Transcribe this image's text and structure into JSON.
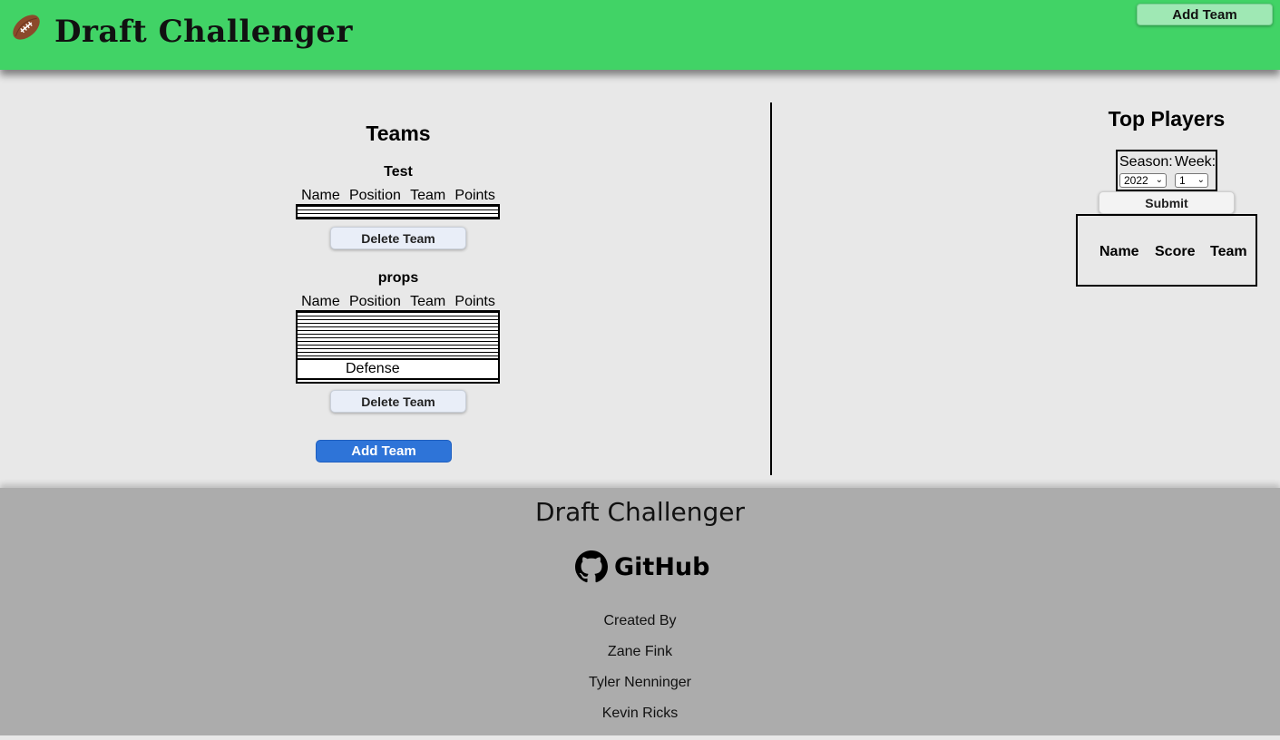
{
  "header": {
    "title": "Draft Challenger",
    "add_team_label": "Add Team",
    "logo_icon": "football-icon",
    "background_color": "#41d366"
  },
  "teams_panel": {
    "heading": "Teams",
    "columns": [
      "Name",
      "Position",
      "Team",
      "Points"
    ],
    "teams": [
      {
        "name": "Test",
        "rows": []
      },
      {
        "name": "props",
        "rows": [
          {
            "name": "",
            "position": "Defense",
            "team": "",
            "points": ""
          }
        ]
      }
    ],
    "delete_label": "Delete Team",
    "add_team_label": "Add Team",
    "add_team_color": "#2e74d8"
  },
  "top_players": {
    "heading": "Top Players",
    "season_label": "Season:",
    "week_label": "Week:",
    "season_value": "2022",
    "week_value": "1",
    "submit_label": "Submit",
    "columns": [
      "Name",
      "Score",
      "Team"
    ]
  },
  "footer": {
    "title": "Draft Challenger",
    "github_label": "GitHub",
    "credits": [
      "Created By",
      "Zane Fink",
      "Tyler Nenninger",
      "Kevin Ricks"
    ],
    "background_color": "#acacac"
  }
}
